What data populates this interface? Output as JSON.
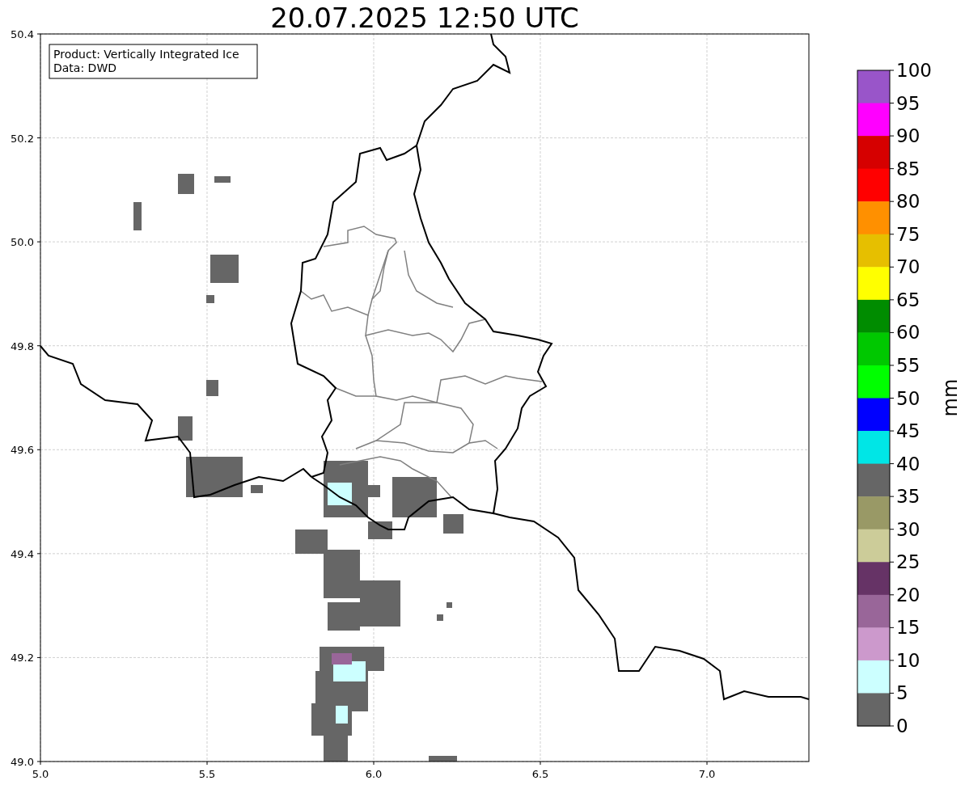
{
  "title": "20.07.2025 12:50 UTC",
  "legend": [
    "Product: Vertically Integrated Ice",
    "Data: DWD"
  ],
  "x_ticks": [
    "5.0",
    "5.5",
    "6.0",
    "6.5",
    "7.0"
  ],
  "y_ticks": [
    "50.4",
    "50.2",
    "50.0",
    "49.8",
    "49.6",
    "49.4",
    "49.2",
    "49.0"
  ],
  "colorbar": {
    "label": "mm",
    "ticks": [
      "100",
      "95",
      "90",
      "85",
      "80",
      "75",
      "70",
      "65",
      "60",
      "55",
      "50",
      "45",
      "40",
      "35",
      "30",
      "25",
      "20",
      "15",
      "10",
      "5",
      "0"
    ],
    "bins": [
      {
        "color": "#9955c9"
      },
      {
        "color": "#ff00ff"
      },
      {
        "color": "#d60000"
      },
      {
        "color": "#ff0000"
      },
      {
        "color": "#ff9000"
      },
      {
        "color": "#e6bf00"
      },
      {
        "color": "#ffff00"
      },
      {
        "color": "#008c00"
      },
      {
        "color": "#00c800"
      },
      {
        "color": "#00ff00"
      },
      {
        "color": "#0000ff"
      },
      {
        "color": "#00e6e6"
      },
      {
        "color": "#666666"
      },
      {
        "color": "#999966"
      },
      {
        "color": "#cccc99"
      },
      {
        "color": "#663366"
      },
      {
        "color": "#996699"
      },
      {
        "color": "#cc99cc"
      },
      {
        "color": "#ccffff"
      },
      {
        "color": "#666666"
      }
    ]
  }
}
